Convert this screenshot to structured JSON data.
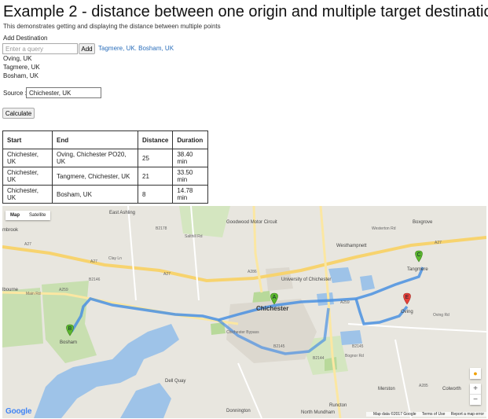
{
  "page": {
    "title": "Example 2 - distance between one origin and multiple target destinations",
    "description": "This demonstrates getting and displaying the distance between multiple points"
  },
  "add_destination": {
    "label": "Add Destination",
    "placeholder": "Enter a query",
    "button_label": "Add",
    "link_text": "Tagmere, UK. Bosham, UK"
  },
  "destinations": [
    "Oving, UK",
    "Tagmere, UK",
    "Bosham, UK"
  ],
  "source": {
    "label": "Source :",
    "value": "Chichester, UK"
  },
  "calculate_label": "Calculate",
  "table": {
    "headers": [
      "Start",
      "End",
      "Distance",
      "Duration"
    ],
    "rows": [
      [
        "Chichester, UK",
        "Oving, Chichester PO20, UK",
        "25",
        "38.40 min"
      ],
      [
        "Chichester, UK",
        "Tangmere, Chichester, UK",
        "21",
        "33.50 min"
      ],
      [
        "Chichester, UK",
        "Bosham, UK",
        "8",
        "14.78 min"
      ]
    ]
  },
  "map": {
    "type_buttons": [
      "Map",
      "Satellite"
    ],
    "selected_type": "Map",
    "zoom_in": "+",
    "zoom_out": "−",
    "logo": "Google",
    "attribution": [
      "Map data ©2017 Google",
      "Terms of Use",
      "Report a map error"
    ],
    "markers": [
      {
        "letter": "A",
        "color": "#5cb82e"
      },
      {
        "letter": "B",
        "color": "#5cb82e"
      },
      {
        "letter": "C",
        "color": "#5cb82e"
      },
      {
        "letter": "E",
        "color": "#e8413a"
      }
    ],
    "route_color": "#4a90e2",
    "places": [
      "East Ashling",
      "Goodwood Motor Circuit",
      "Boxgrove",
      "Westhampnett",
      "Tangmere",
      "University of Chichester",
      "Chichester",
      "Oving",
      "Bosham",
      "Dell Quay",
      "Merston",
      "Colworth",
      "Donnington",
      "North Mundham",
      "Runcton",
      "mbrook",
      "lbourne"
    ],
    "roads": [
      "A27",
      "A27",
      "A27",
      "A27",
      "A259",
      "A259",
      "A286",
      "B2145",
      "A285",
      "B2178",
      "B2146",
      "B2144",
      "B2145",
      "Chichester Bypass",
      "Oving Rd",
      "Bognor Rd",
      "Main Rd",
      "Clay Ln",
      "Salthill Rd",
      "Westerton Rd"
    ]
  }
}
